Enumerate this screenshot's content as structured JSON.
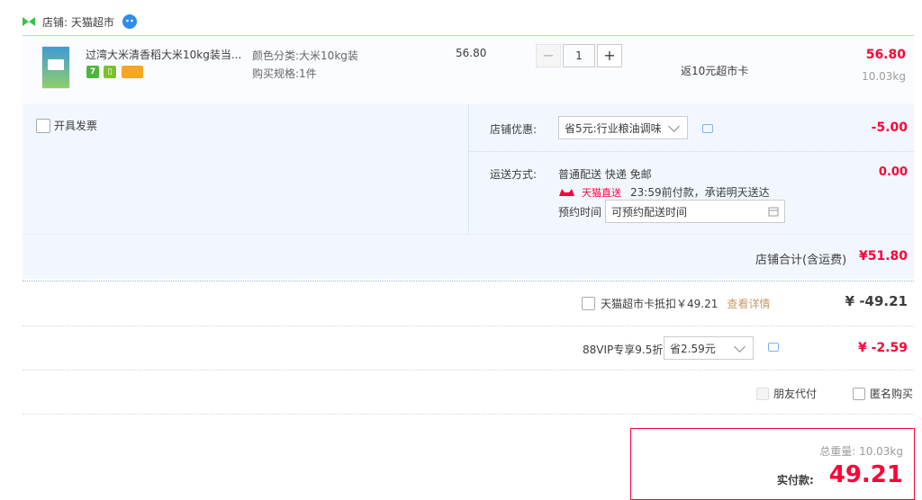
{
  "shop": {
    "label": "店铺: 天猫超市"
  },
  "item": {
    "title": "过湾大米清香稻大米10kg装当...",
    "sku_color_label": "颜色分类:",
    "sku_color_value": "大米10kg装",
    "sku_spec_label": "购买规格:",
    "sku_spec_value": "1件",
    "unit_price": "56.80",
    "quantity": "1",
    "rebate": "返10元超市卡",
    "subtotal": "56.80",
    "weight": "10.03kg",
    "badges": [
      "7",
      "",
      ""
    ]
  },
  "invoice": {
    "label": "开具发票"
  },
  "shop_discount": {
    "label": "店铺优惠:",
    "value": "省5元:行业粮油调味",
    "amount": "-5.00"
  },
  "shipping": {
    "label": "运送方式:",
    "method": "普通配送 快递 免邮",
    "amount": "0.00",
    "service_badge": "天猫直送",
    "promise": "23:59前付款，承诺明天送达",
    "reserve_label": "预约时间",
    "reserve_placeholder": "可预约配送时间"
  },
  "shop_total": {
    "label": "店铺合计(含运费)",
    "value": "¥51.80"
  },
  "card_deduct": {
    "label": "天猫超市卡抵扣￥49.21",
    "detail_link": "查看详情",
    "amount": "¥ -49.21"
  },
  "vip": {
    "label": "88VIP专享9.5折",
    "select_value": "省2.59元",
    "amount": "¥ -2.59"
  },
  "options": {
    "friend_pay": "朋友代付",
    "anonymous": "匿名购买"
  },
  "final": {
    "weight_label": "总重量: 10.03kg",
    "pay_label": "实付款:",
    "pay_value": "49.21"
  },
  "colors": {
    "accent_red": "#ff0036",
    "light_blue": "#f2f7ff",
    "border_blue": "#b2d1ff"
  }
}
